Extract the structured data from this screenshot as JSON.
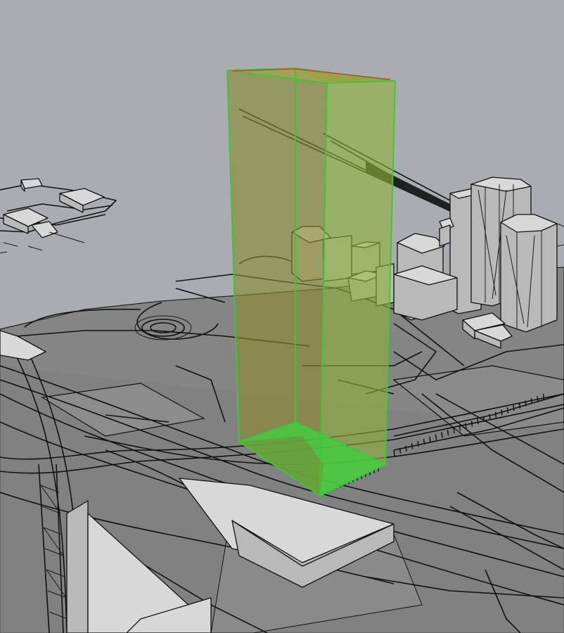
{
  "viewport": {
    "background": "#a9adb2",
    "ground_color": "#858585",
    "building_color": "#d3d3d3",
    "edge_color": "#111111"
  },
  "selection": {
    "fill_color": "#8fb23a",
    "edge_color": "#33cc33",
    "highlight_edge_color": "#cc3333",
    "opacity": 0.62
  }
}
